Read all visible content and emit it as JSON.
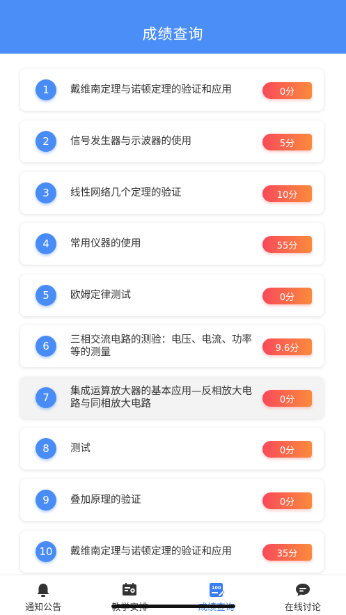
{
  "header": {
    "title": "成绩查询"
  },
  "items": [
    {
      "num": "1",
      "title": "戴维南定理与诺顿定理的验证和应用",
      "score": "0分"
    },
    {
      "num": "2",
      "title": "信号发生器与示波器的使用",
      "score": "5分"
    },
    {
      "num": "3",
      "title": "线性网络几个定理的验证",
      "score": "10分"
    },
    {
      "num": "4",
      "title": "常用仪器的使用",
      "score": "55分"
    },
    {
      "num": "5",
      "title": "欧姆定律测试",
      "score": "0分"
    },
    {
      "num": "6",
      "title": "三相交流电路的测验：电压、电流、功率等的测量",
      "score": "9.6分"
    },
    {
      "num": "7",
      "title": "集成运算放大器的基本应用—反相放大电路与同相放大电路",
      "score": "0分"
    },
    {
      "num": "8",
      "title": "测试",
      "score": "0分"
    },
    {
      "num": "9",
      "title": "叠加原理的验证",
      "score": "0分"
    },
    {
      "num": "10",
      "title": "戴维南定理与诺顿定理的验证和应用",
      "score": "35分"
    }
  ],
  "tabbar": {
    "tabs": [
      {
        "label": "通知公告",
        "icon": "bell-icon"
      },
      {
        "label": "教学安排",
        "icon": "schedule-icon"
      },
      {
        "label": "成绩查询",
        "icon": "score-icon",
        "active": true
      },
      {
        "label": "在线讨论",
        "icon": "chat-icon"
      }
    ]
  },
  "colors": {
    "header": "#4b8ef8",
    "number_badge": "#4a8cf6",
    "score_gradient_start": "#f94a5a",
    "score_gradient_end": "#fb8a3c",
    "active_tab": "#3a7cf2"
  }
}
